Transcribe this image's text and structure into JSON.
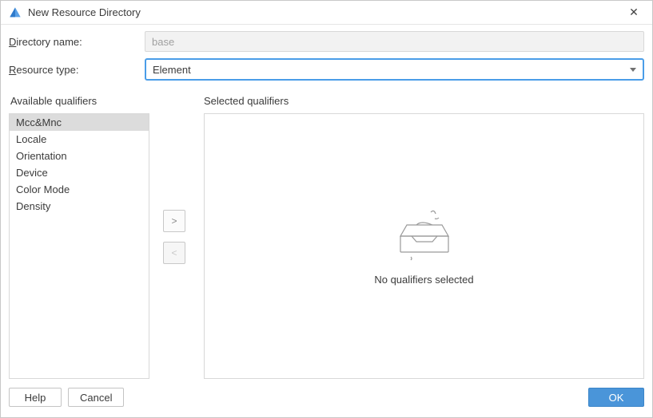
{
  "titlebar": {
    "title": "New Resource Directory"
  },
  "form": {
    "directory_label_pre": "D",
    "directory_label_rest": "irectory name:",
    "directory_value": "base",
    "resource_label_pre": "R",
    "resource_label_rest": "esource type:",
    "resource_value": "Element"
  },
  "available": {
    "heading": "Available qualifiers",
    "items": [
      "Mcc&Mnc",
      "Locale",
      "Orientation",
      "Device",
      "Color Mode",
      "Density"
    ],
    "selected_index": 0
  },
  "buttons_mid": {
    "add": ">",
    "remove": "<"
  },
  "selected": {
    "heading": "Selected qualifiers",
    "empty_text": "No qualifiers selected"
  },
  "footer": {
    "help": "Help",
    "cancel": "Cancel",
    "ok": "OK"
  }
}
